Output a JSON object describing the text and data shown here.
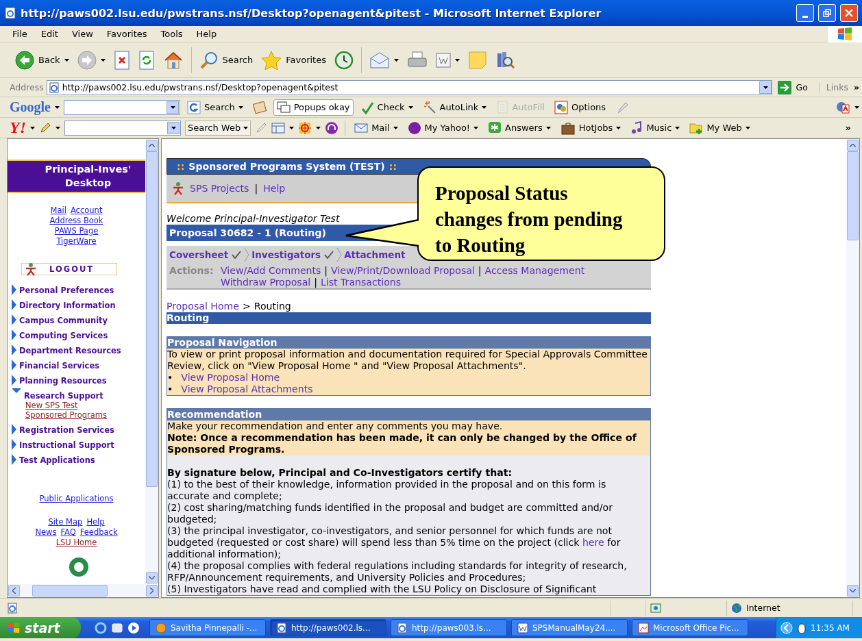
{
  "window": {
    "title": "http://paws002.lsu.edu/pwstrans.nsf/Desktop?openagent&pitest - Microsoft Internet Explorer"
  },
  "menu": [
    "File",
    "Edit",
    "View",
    "Favorites",
    "Tools",
    "Help"
  ],
  "toolbar": [
    {
      "kind": "back",
      "label": "Back",
      "dropdown": true
    },
    {
      "kind": "forward",
      "dropdown": true
    },
    {
      "kind": "stop",
      "dropdown": false
    },
    {
      "kind": "refresh",
      "dropdown": false
    },
    {
      "kind": "home",
      "dropdown": false
    },
    {
      "kind": "search",
      "label": "Search",
      "dropdown": false
    },
    {
      "kind": "favorites",
      "label": "Favorites",
      "dropdown": false
    },
    {
      "kind": "history",
      "dropdown": false
    },
    {
      "kind": "mail",
      "dropdown": true
    },
    {
      "kind": "print",
      "dropdown": false
    },
    {
      "kind": "edit",
      "dropdown": true
    },
    {
      "kind": "note",
      "dropdown": false
    },
    {
      "kind": "research",
      "dropdown": false
    }
  ],
  "address": {
    "label": "Address",
    "value": "http://paws002.lsu.edu/pwstrans.nsf/Desktop?openagent&pitest",
    "go": "Go",
    "links": "Links",
    "more": "»"
  },
  "google": {
    "logo": "Google",
    "items": [
      {
        "kind": "search",
        "label": "Search",
        "disabled": false,
        "dropdown": true
      },
      {
        "kind": "blocker",
        "disabled": false,
        "dropdown": false
      },
      {
        "kind": "popups",
        "label": "Popups okay",
        "disabled": false,
        "dropdown": false
      },
      {
        "kind": "check",
        "label": "Check",
        "disabled": false,
        "dropdown": true
      },
      {
        "kind": "autolink",
        "label": "AutoLink",
        "disabled": false,
        "dropdown": true
      },
      {
        "kind": "autofill",
        "label": "AutoFill",
        "disabled": true,
        "dropdown": false
      },
      {
        "kind": "options",
        "label": "Options",
        "disabled": false,
        "dropdown": false
      },
      {
        "kind": "highlight",
        "disabled": false,
        "dropdown": false
      }
    ]
  },
  "yahoo": {
    "logo": "Y!",
    "search_button": "Search Web",
    "more": "»",
    "items": [
      {
        "kind": "mail",
        "label": "Mail"
      },
      {
        "kind": "myyahoo",
        "label": "My Yahoo!"
      },
      {
        "kind": "answers",
        "label": "Answers"
      },
      {
        "kind": "hotjobs",
        "label": "HotJobs"
      },
      {
        "kind": "music",
        "label": "Music"
      },
      {
        "kind": "myweb",
        "label": "My Web"
      }
    ]
  },
  "sidebar": {
    "title": "Principal-Inves' Desktop",
    "link_rows": [
      [
        {
          "label": "Mail",
          "visited": false
        },
        {
          "label": "Account",
          "visited": false
        }
      ],
      [
        {
          "label": "Address Book",
          "visited": false
        }
      ],
      [
        {
          "label": "PAWS Page",
          "visited": false
        }
      ],
      [
        {
          "label": "TigerWare",
          "visited": false
        }
      ]
    ],
    "logout": "LOGOUT",
    "nav": [
      {
        "label": "Personal Preferences",
        "expanded": false
      },
      {
        "label": "Directory Information",
        "expanded": false
      },
      {
        "label": "Campus Community",
        "expanded": false
      },
      {
        "label": "Computing Services",
        "expanded": false
      },
      {
        "label": "Department Resources",
        "expanded": false
      },
      {
        "label": "Financial Services",
        "expanded": false
      },
      {
        "label": "Planning Resources",
        "expanded": false
      },
      {
        "label": "Research Support",
        "expanded": true,
        "children": [
          {
            "label": "New SPS Test",
            "visited": true
          },
          {
            "label": "Sponsored Programs",
            "visited": true
          }
        ]
      },
      {
        "label": "Registration Services",
        "expanded": false
      },
      {
        "label": "Instructional Support",
        "expanded": false
      },
      {
        "label": "Test Applications",
        "expanded": false
      }
    ],
    "public": {
      "label": "Public Applications",
      "visited": false
    },
    "footer_rows": [
      [
        {
          "label": "Site Map",
          "visited": false
        },
        {
          "label": "Help",
          "visited": false
        }
      ],
      [
        {
          "label": "News",
          "visited": false
        },
        {
          "label": "FAQ",
          "visited": false
        },
        {
          "label": "Feedback",
          "visited": false
        }
      ],
      [
        {
          "label": "LSU Home",
          "visited": true
        }
      ]
    ]
  },
  "main": {
    "header": {
      "mark": "::",
      "title": "Sponsored Programs System (TEST)"
    },
    "separator": "|",
    "top_links": [
      "SPS Projects",
      "Help"
    ],
    "welcome": "Welcome Principal-Investigator Test",
    "proposal_title": "Proposal 30682 - 1 (Routing)",
    "tabs": [
      {
        "label": "Coversheet",
        "complete": true
      },
      {
        "label": "Investigators",
        "complete": true
      },
      {
        "label": "Attachment",
        "complete": false
      }
    ],
    "actions": {
      "label": "Actions:",
      "rows": [
        [
          "View/Add Comments",
          "View/Print/Download Proposal",
          "Access Management"
        ],
        [
          "Withdraw Proposal",
          "List Transactions"
        ]
      ]
    },
    "breadcrumb": {
      "link": "Proposal Home",
      "arrow": ">",
      "current": "Routing"
    },
    "section_title": "Routing",
    "navigation": {
      "title": "Proposal Navigation",
      "text": "To view or print proposal information and documentation required for Special Approvals Committee Review, click on \"View Proposal Home \" and \"View Proposal Attachments\".",
      "bullet": "•",
      "links": [
        "View Proposal Home",
        "View Proposal Attachments"
      ]
    },
    "recommendation": {
      "title": "Recommendation",
      "intro": "Make your recommendation and enter any comments you may have.",
      "note": "Note: Once a recommendation has been made, it can only be changed by the Office of Sponsored Programs.",
      "heading": "By signature below, Principal and Co-Investigators certify that:",
      "items": [
        {
          "text": "(1) to the best of their knowledge, information provided in the proposal and on this form is accurate and complete;"
        },
        {
          "text": "(2) cost sharing/matching funds identified in the proposal and budget are committed and/or budgeted;"
        },
        {
          "text": "(3) the principal investigator, co-investigators, and senior personnel for which funds are not budgeted (requested or cost share) will spend less than 5% time on the project (click ",
          "link": "here",
          "after": " for additional information);"
        },
        {
          "text": "(4) the proposal complies with federal regulations including standards for integrity of research, RFP/Announcement requirements, and University Policies and Procedures;"
        },
        {
          "text": "(5) Investigators have read and complied with the LSU Policy on Disclosure of Significant"
        }
      ]
    }
  },
  "callout": {
    "lines": [
      "Proposal Status",
      "changes from pending",
      "to Routing"
    ]
  },
  "status_bar": {
    "zone": "Internet"
  },
  "taskbar": {
    "start": "start",
    "clock": "11:35 AM",
    "tasks": [
      {
        "kind": "messenger",
        "label": "Savitha Pinnepalli -...",
        "selected": false
      },
      {
        "kind": "browser",
        "label": "http://paws002.ls...",
        "selected": true
      },
      {
        "kind": "browser",
        "label": "http://paws003.ls...",
        "selected": false
      },
      {
        "kind": "word",
        "label": "SPSManualMay24....",
        "selected": false
      },
      {
        "kind": "picture",
        "label": "Microsoft Office Pic...",
        "selected": false
      }
    ]
  }
}
